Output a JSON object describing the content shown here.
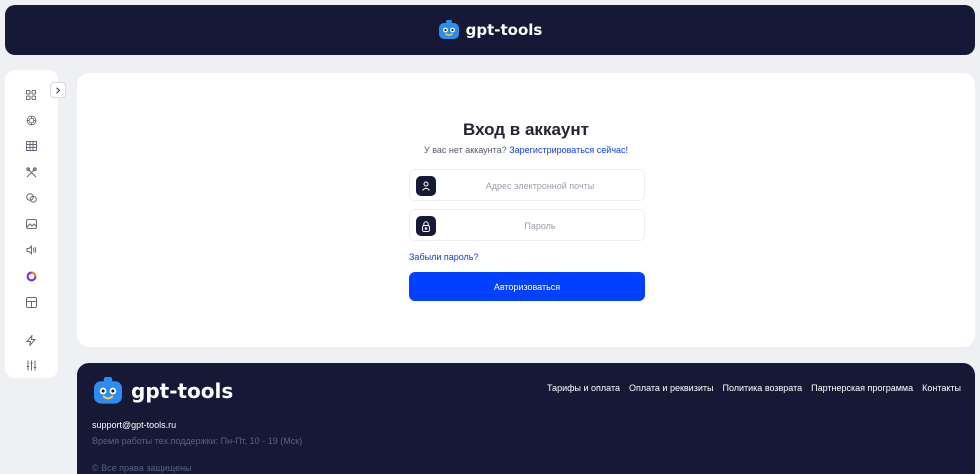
{
  "header": {
    "brand_name": "gpt-tools"
  },
  "sidebar": {
    "items": [
      {
        "icon": "grid-icon"
      },
      {
        "icon": "openai-icon"
      },
      {
        "icon": "table-icon"
      },
      {
        "icon": "tools-icon"
      },
      {
        "icon": "chat-icon"
      },
      {
        "icon": "image-icon"
      },
      {
        "icon": "speaker-icon"
      },
      {
        "icon": "ring-logo-icon"
      },
      {
        "icon": "box-icon"
      },
      {
        "icon": "lightning-icon"
      },
      {
        "icon": "sliders-icon"
      }
    ],
    "expand_icon": "chevron-right-icon"
  },
  "login": {
    "title": "Вход в аккаунт",
    "no_account_text": "У вас нет аккаунта?",
    "register_link": "Зарегистрироваться сейчас!",
    "email_placeholder": "Адрес электронной почты",
    "email_value": "",
    "password_placeholder": "Пароль",
    "password_value": "",
    "forgot_link": "Забыли пароль?",
    "submit_label": "Авторизоваться"
  },
  "footer": {
    "brand_name": "gpt-tools",
    "nav": [
      "Тарифы и оплата",
      "Оплата и реквизиты",
      "Политика возврата",
      "Партнерская программа",
      "Контакты"
    ],
    "support_email": "support@gpt-tools.ru",
    "support_hours": "Время работы тех.поддержки: Пн-Пт, 10 - 19 (Мск)",
    "copyright": "© Все права защищены"
  },
  "colors": {
    "dark": "#151936",
    "accent": "#0040ff",
    "link": "#0a3de8",
    "mascot": "#2d8cf0"
  }
}
